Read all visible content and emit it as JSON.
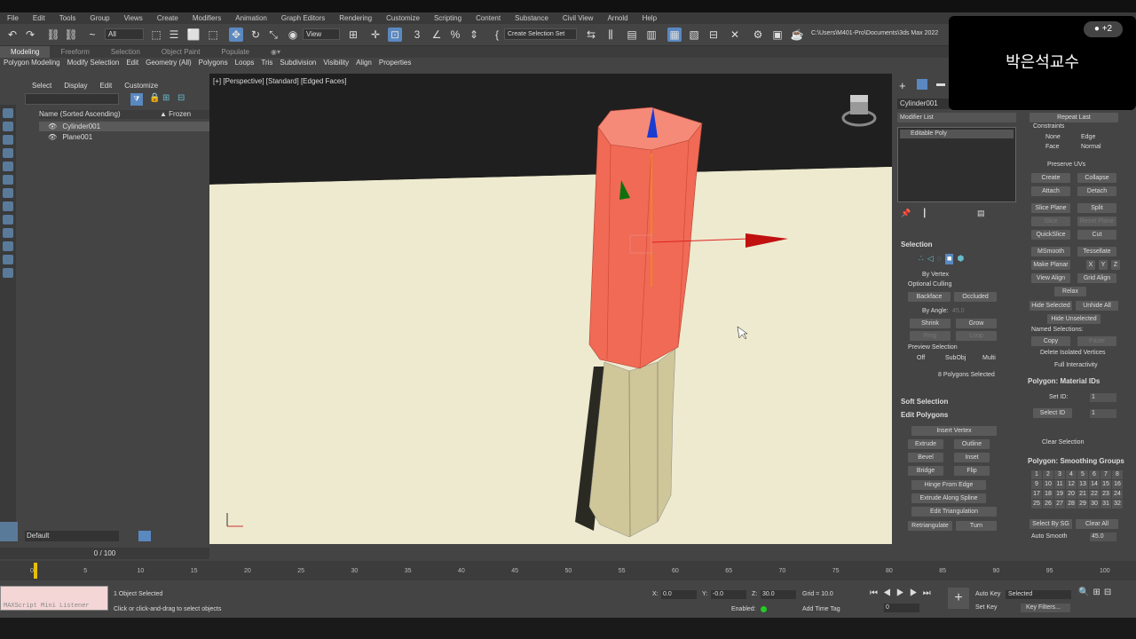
{
  "menu": [
    "File",
    "Edit",
    "Tools",
    "Group",
    "Views",
    "Create",
    "Modifiers",
    "Animation",
    "Graph Editors",
    "Rendering",
    "Customize",
    "Scripting",
    "Content",
    "Substance",
    "Civil View",
    "Arnold",
    "Help"
  ],
  "toolbar": {
    "filter": "All",
    "view": "View",
    "selection_set": "Create Selection Set",
    "path": "C:\\Users\\M401-Pro\\Documents\\3ds Max 2022"
  },
  "ribbon_tabs": [
    "Modeling",
    "Freeform",
    "Selection",
    "Object Paint",
    "Populate"
  ],
  "ribbon_items": [
    "Polygon Modeling",
    "Modify Selection",
    "Edit",
    "Geometry (All)",
    "Polygons",
    "Loops",
    "Tris",
    "Subdivision",
    "Visibility",
    "Align",
    "Properties"
  ],
  "scene": {
    "menu": [
      "Select",
      "Display",
      "Edit",
      "Customize"
    ],
    "col_name": "Name (Sorted Ascending)",
    "col_frozen": "▲ Frozen",
    "objects": [
      "Cylinder001",
      "Plane001"
    ],
    "layer": "Default"
  },
  "viewport": {
    "label": "[+] [Perspective] [Standard] [Edged Faces]"
  },
  "command": {
    "object_name": "Cylinder001",
    "modifier_list": "Modifier List",
    "stack_item": "Editable Poly",
    "selection": {
      "title": "Selection",
      "by_vertex": "By Vertex",
      "optional_culling": "Optional Culling",
      "backface": "Backface",
      "occluded": "Occluded",
      "by_angle": "By Angle:",
      "angle": "45.0",
      "shrink": "Shrink",
      "grow": "Grow",
      "ring": "Ring",
      "loop": "Loop",
      "preview": "Preview Selection",
      "off": "Off",
      "subobj": "SubObj",
      "multi": "Multi",
      "status": "8 Polygons Selected"
    },
    "soft_selection": "Soft Selection",
    "edit_polygons": {
      "title": "Edit Polygons",
      "insert_vertex": "Insert Vertex",
      "extrude": "Extrude",
      "outline": "Outline",
      "bevel": "Bevel",
      "inset": "Inset",
      "bridge": "Bridge",
      "flip": "Flip",
      "hinge": "Hinge From Edge",
      "extrude_spline": "Extrude Along Spline",
      "edit_tri": "Edit Triangulation",
      "retriangulate": "Retriangulate",
      "turn": "Turn"
    }
  },
  "right": {
    "repeat_last": "Repeat Last",
    "constraints": "Constraints",
    "none": "None",
    "edge": "Edge",
    "face": "Face",
    "normal": "Normal",
    "preserve_uvs": "Preserve UVs",
    "create": "Create",
    "collapse": "Collapse",
    "attach": "Attach",
    "detach": "Detach",
    "slice_plane": "Slice Plane",
    "split": "Split",
    "slice": "Slice",
    "reset_plane": "Reset Plane",
    "quickslice": "QuickSlice",
    "cut": "Cut",
    "msmooth": "MSmooth",
    "tessellate": "Tessellate",
    "make_planar": "Make Planar",
    "x": "X",
    "y": "Y",
    "z": "Z",
    "view_align": "View Align",
    "grid_align": "Grid Align",
    "relax": "Relax",
    "hide_selected": "Hide Selected",
    "unhide_all": "Unhide All",
    "hide_unselected": "Hide Unselected",
    "named_sel": "Named Selections:",
    "copy": "Copy",
    "paste": "Paste",
    "delete_iso": "Delete Isolated Vertices",
    "full_interactivity": "Full Interactivity",
    "mat_ids": "Polygon: Material IDs",
    "set_id": "Set ID:",
    "set_id_val": "1",
    "select_id": "Select ID",
    "select_id_val": "1",
    "clear_selection": "Clear Selection",
    "smoothing": "Polygon: Smoothing Groups",
    "sg": [
      "1",
      "2",
      "3",
      "4",
      "5",
      "6",
      "7",
      "8",
      "9",
      "10",
      "11",
      "12",
      "13",
      "14",
      "15",
      "16",
      "17",
      "18",
      "19",
      "20",
      "21",
      "22",
      "23",
      "24",
      "25",
      "26",
      "27",
      "28",
      "29",
      "30",
      "31",
      "32"
    ],
    "select_by_sg": "Select By SG",
    "clear_all": "Clear All",
    "auto_smooth": "Auto Smooth",
    "auto_smooth_val": "45.0"
  },
  "timeline": {
    "frame": "0 / 100",
    "ticks": [
      "0",
      "5",
      "10",
      "15",
      "20",
      "25",
      "30",
      "35",
      "40",
      "45",
      "50",
      "55",
      "60",
      "65",
      "70",
      "75",
      "80",
      "85",
      "90",
      "95",
      "100"
    ]
  },
  "status": {
    "listener": "MAXScript Mini Listener",
    "selected": "1 Object Selected",
    "prompt": "Click or click-and-drag to select objects",
    "x": "0.0",
    "y": "-0.0",
    "z": "30.0",
    "grid": "Grid = 10.0",
    "enabled": "Enabled:",
    "add_time_tag": "Add Time Tag",
    "auto_key": "Auto Key",
    "set_key": "Set Key",
    "selected_dd": "Selected",
    "key_filters": "Key Filters...",
    "frame_field": "0"
  },
  "overlay": {
    "name": "박은석교수",
    "badge": "+2"
  }
}
